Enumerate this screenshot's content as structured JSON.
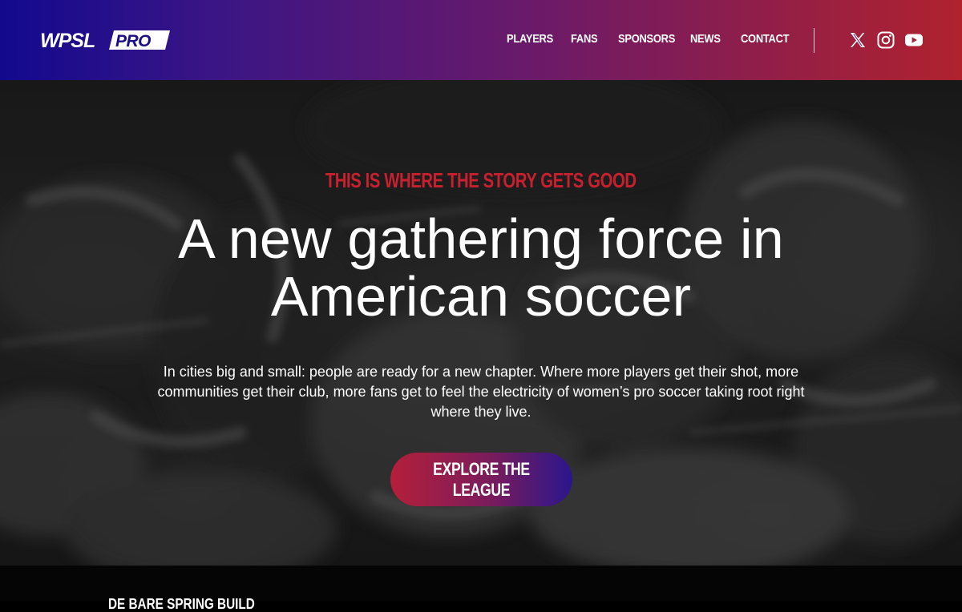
{
  "header": {
    "logo_text": "WPSL PRO",
    "nav": [
      "PLAYERS",
      "FANS",
      "SPONSORS",
      "NEWS",
      "CONTACT"
    ],
    "social_icons": [
      "x-icon",
      "instagram-icon",
      "youtube-icon"
    ]
  },
  "hero": {
    "eyebrow": "THIS IS WHERE THE STORY GETS GOOD",
    "headline": "A new gathering force in American soccer",
    "body": "In cities big and small: people are ready for a new chapter. Where more players get their shot, more communities get their club, more fans get to feel the electricity of women’s pro soccer taking root right where they live.",
    "cta_label": "EXPLORE THE LEAGUE"
  },
  "next_section": {
    "peek_text": "DE BARE SPRING BUILD"
  },
  "colors": {
    "accent_red": "#c8202f",
    "header_gradient_start": "#12098f",
    "header_gradient_end": "#b0222e"
  }
}
